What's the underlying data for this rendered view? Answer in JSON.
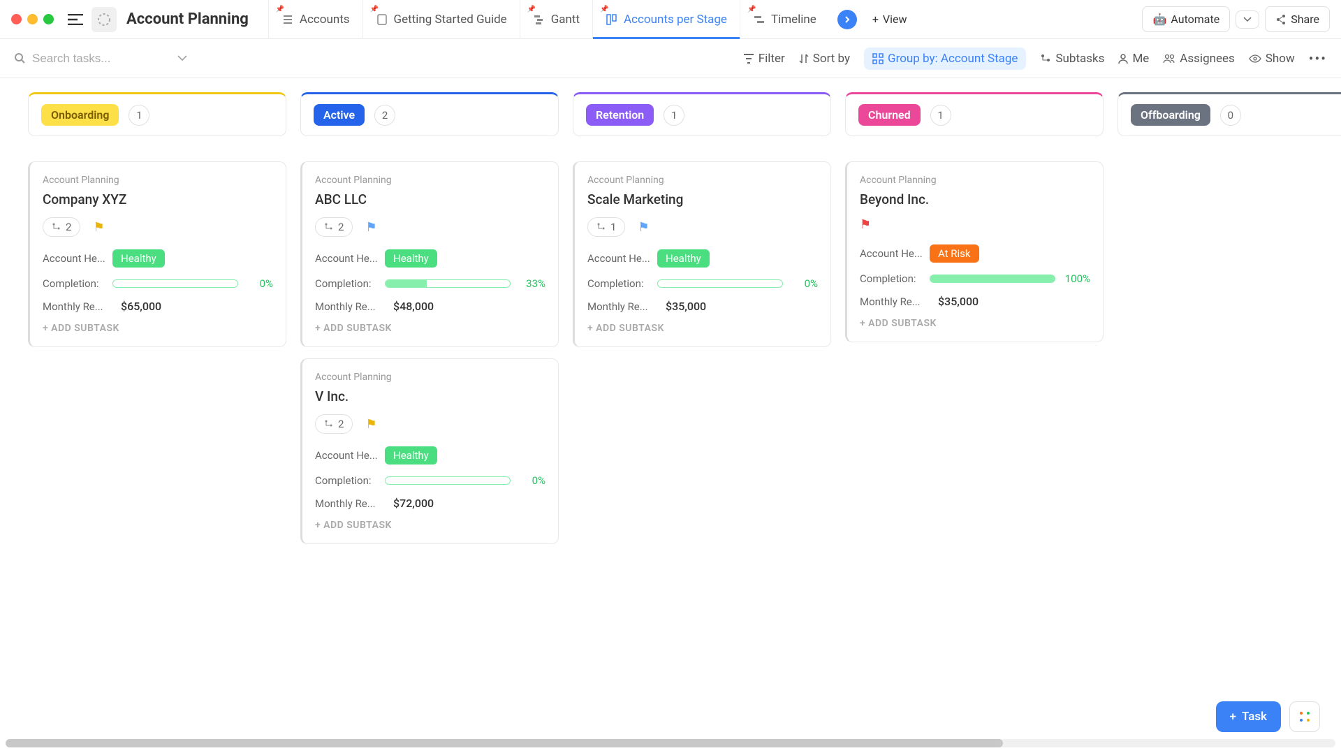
{
  "page_title": "Account Planning",
  "search_placeholder": "Search tasks...",
  "tabs": [
    {
      "label": "Accounts",
      "icon": "list"
    },
    {
      "label": "Getting Started Guide",
      "icon": "doc"
    },
    {
      "label": "Gantt",
      "icon": "gantt"
    },
    {
      "label": "Accounts per Stage",
      "icon": "board",
      "active": true
    },
    {
      "label": "Timeline",
      "icon": "timeline"
    }
  ],
  "top_buttons": {
    "view": "View",
    "automate": "Automate",
    "share": "Share"
  },
  "toolbar": {
    "filter": "Filter",
    "sort": "Sort by",
    "group": "Group by: Account Stage",
    "subtasks": "Subtasks",
    "me": "Me",
    "assignees": "Assignees",
    "show": "Show"
  },
  "columns": [
    {
      "stage": "Onboarding",
      "class": "onboarding",
      "count": 1,
      "cards": [
        {
          "crumb": "Account Planning",
          "title": "Company XYZ",
          "subtasks": 2,
          "flag": "yellow",
          "health": "Healthy",
          "health_class": "healthy",
          "completion": 0,
          "revenue": "$65,000"
        }
      ]
    },
    {
      "stage": "Active",
      "class": "active-c",
      "count": 2,
      "cards": [
        {
          "crumb": "Account Planning",
          "title": "ABC LLC",
          "subtasks": 2,
          "flag": "blue",
          "health": "Healthy",
          "health_class": "healthy",
          "completion": 33,
          "revenue": "$48,000"
        },
        {
          "crumb": "Account Planning",
          "title": "V Inc.",
          "subtasks": 2,
          "flag": "yellow",
          "health": "Healthy",
          "health_class": "healthy",
          "completion": 0,
          "revenue": "$72,000"
        }
      ]
    },
    {
      "stage": "Retention",
      "class": "retention",
      "count": 1,
      "cards": [
        {
          "crumb": "Account Planning",
          "title": "Scale Marketing",
          "subtasks": 1,
          "flag": "blue",
          "health": "Healthy",
          "health_class": "healthy",
          "completion": 0,
          "revenue": "$35,000"
        }
      ]
    },
    {
      "stage": "Churned",
      "class": "churned",
      "count": 1,
      "cards": [
        {
          "crumb": "Account Planning",
          "title": "Beyond Inc.",
          "subtasks": null,
          "flag": "red",
          "health": "At Risk",
          "health_class": "atrisk",
          "completion": 100,
          "revenue": "$35,000"
        }
      ]
    },
    {
      "stage": "Offboarding",
      "class": "offboarding",
      "count": 0,
      "cards": []
    }
  ],
  "labels": {
    "health": "Account He...",
    "completion": "Completion:",
    "revenue": "Monthly Re...",
    "add_subtask": "+ ADD SUBTASK",
    "task_fab": "Task"
  }
}
